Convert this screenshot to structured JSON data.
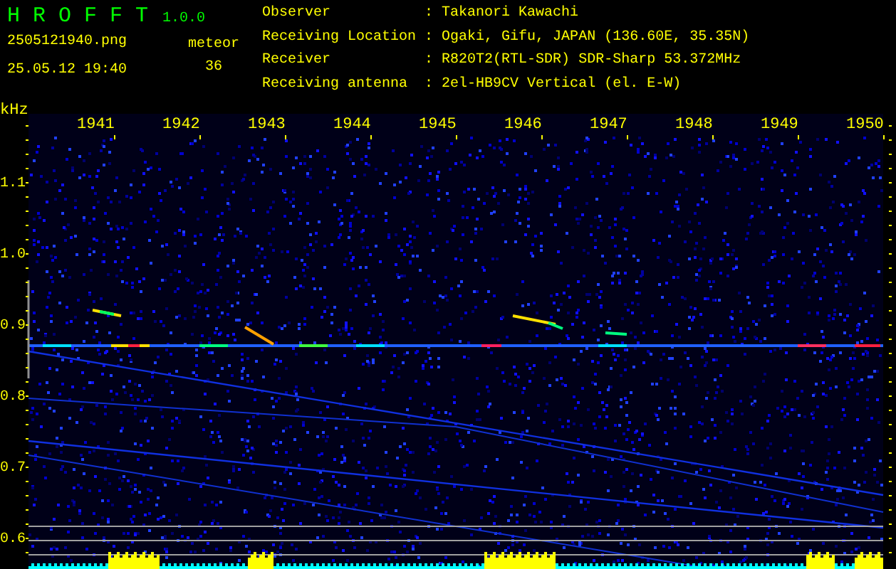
{
  "app": {
    "title": "H R O F F T",
    "version": "1.0.0"
  },
  "file": {
    "name": "2505121940.png",
    "datetime": "25.05.12 19:40"
  },
  "count": {
    "label": "meteor",
    "value": "36"
  },
  "station": [
    {
      "label": "Observer",
      "separator": ":",
      "value": "Takanori Kawachi"
    },
    {
      "label": "Receiving Location",
      "separator": ":",
      "value": "Ogaki, Gifu, JAPAN (136.60E, 35.35N)"
    },
    {
      "label": "Receiver",
      "separator": ":",
      "value": "R820T2(RTL-SDR) SDR-Sharp 53.372MHz"
    },
    {
      "label": "Receiving antenna",
      "separator": ":",
      "value": "2el-HB9CV Vertical (el. E-W)"
    }
  ],
  "spectrogram": {
    "y_unit": "kHz",
    "x_labels": [
      "1941",
      "1942",
      "1943",
      "1944",
      "1945",
      "1946",
      "1947",
      "1948",
      "1949",
      "1950"
    ],
    "y_labels": [
      "1.1",
      "1.0",
      "0.9",
      "0.8",
      "0.7",
      "0.6"
    ]
  }
}
